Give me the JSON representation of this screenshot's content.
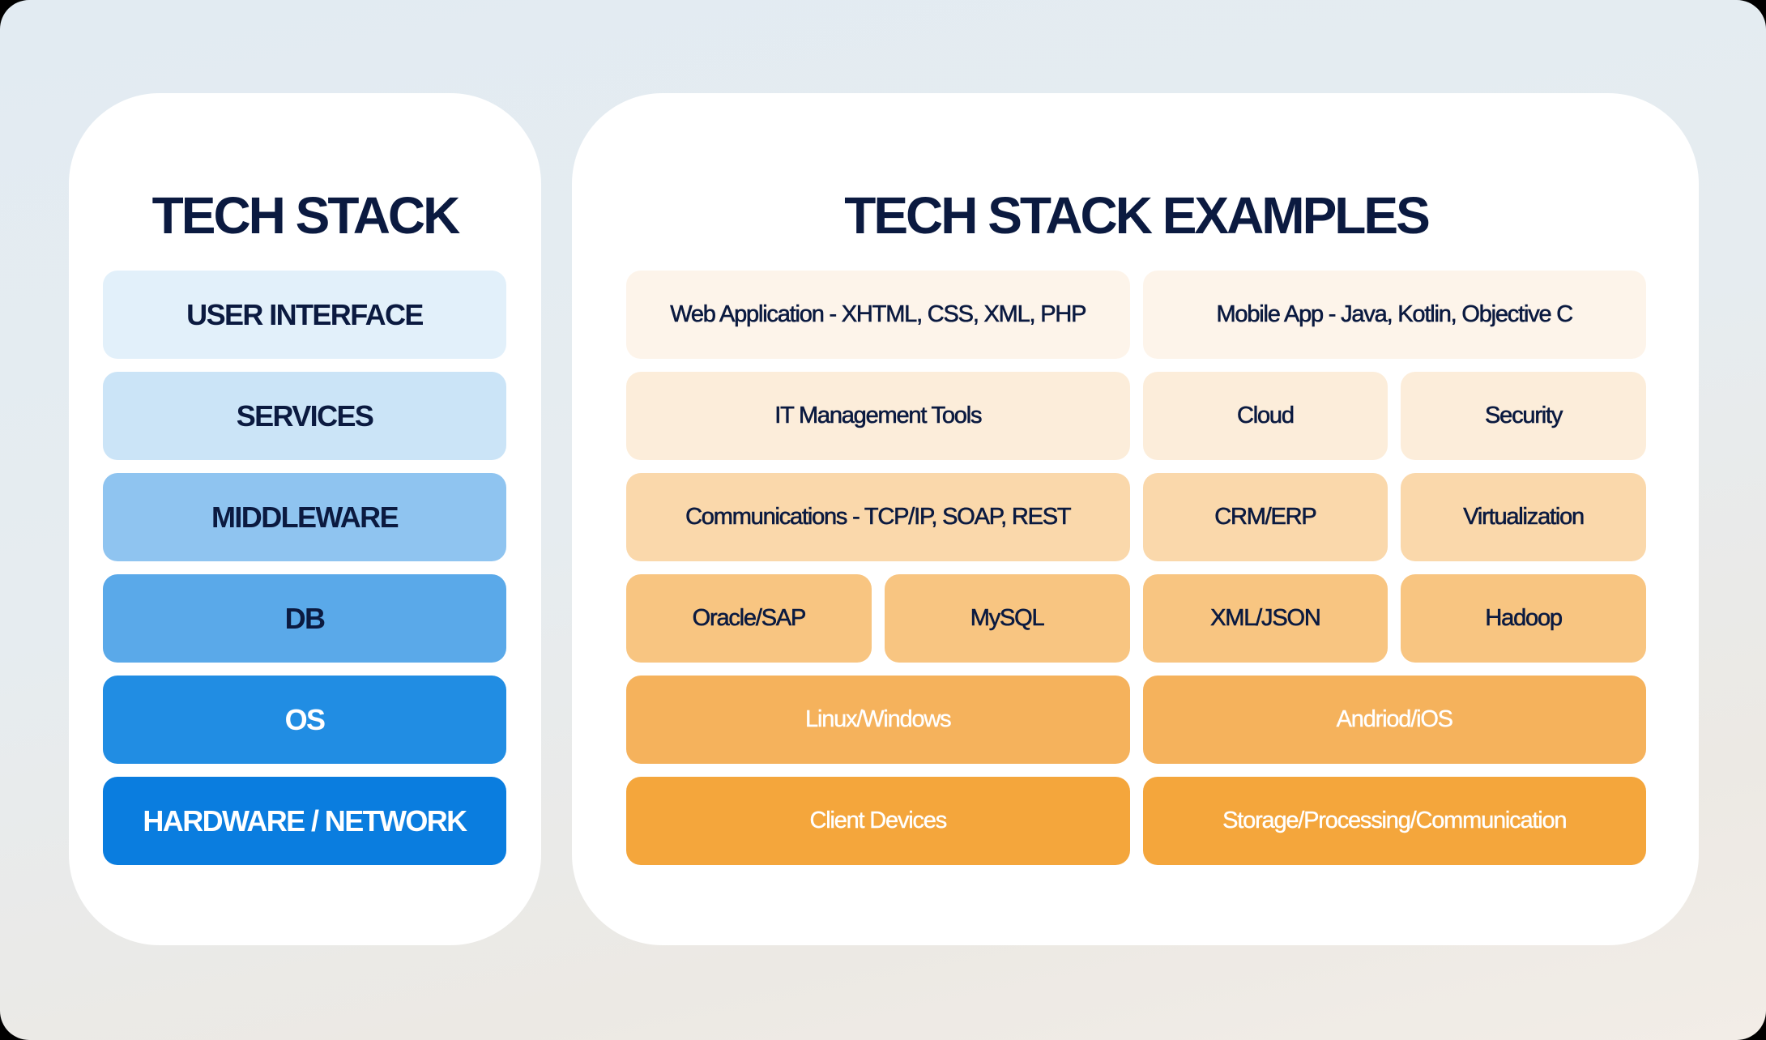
{
  "tech_stack": {
    "title": "TECH STACK",
    "layers": [
      {
        "label": "USER INTERFACE",
        "color": "#e2f0fa",
        "text_color": "#0b1a40"
      },
      {
        "label": "SERVICES",
        "color": "#cbe4f7",
        "text_color": "#0b1a40"
      },
      {
        "label": "MIDDLEWARE",
        "color": "#8fc4f0",
        "text_color": "#0b1a40"
      },
      {
        "label": "DB",
        "color": "#5aa9e9",
        "text_color": "#0b1a40"
      },
      {
        "label": "OS",
        "color": "#218de3",
        "text_color": "#ffffff"
      },
      {
        "label": "HARDWARE / NETWORK",
        "color": "#0a7ddf",
        "text_color": "#ffffff"
      }
    ]
  },
  "examples": {
    "title": "TECH STACK EXAMPLES",
    "rows": [
      {
        "color": "#fdf4ea",
        "text_color": "#0b1a40",
        "cells": [
          {
            "label": "Web Application - XHTML, CSS, XML, PHP",
            "span": 2
          },
          {
            "label": "Mobile App - Java, Kotlin, Objective C",
            "span": 2
          }
        ]
      },
      {
        "color": "#fcedda",
        "text_color": "#0b1a40",
        "cells": [
          {
            "label": "IT Management Tools",
            "span": 2
          },
          {
            "label": "Cloud",
            "span": 1
          },
          {
            "label": "Security",
            "span": 1
          }
        ]
      },
      {
        "color": "#fad8ab",
        "text_color": "#0b1a40",
        "cells": [
          {
            "label": "Communications - TCP/IP, SOAP, REST",
            "span": 2
          },
          {
            "label": "CRM/ERP",
            "span": 1
          },
          {
            "label": "Virtualization",
            "span": 1
          }
        ]
      },
      {
        "color": "#f8c581",
        "text_color": "#0b1a40",
        "cells": [
          {
            "label": "Oracle/SAP",
            "span": 1
          },
          {
            "label": "MySQL",
            "span": 1
          },
          {
            "label": "XML/JSON",
            "span": 1
          },
          {
            "label": "Hadoop",
            "span": 1
          }
        ]
      },
      {
        "color": "#f5b25c",
        "text_color": "#ffffff",
        "cells": [
          {
            "label": "Linux/Windows",
            "span": 2
          },
          {
            "label": "Andriod/iOS",
            "span": 2
          }
        ]
      },
      {
        "color": "#f4a63c",
        "text_color": "#ffffff",
        "cells": [
          {
            "label": "Client Devices",
            "span": 2
          },
          {
            "label": "Storage/Processing/Communication",
            "span": 2
          }
        ]
      }
    ]
  }
}
